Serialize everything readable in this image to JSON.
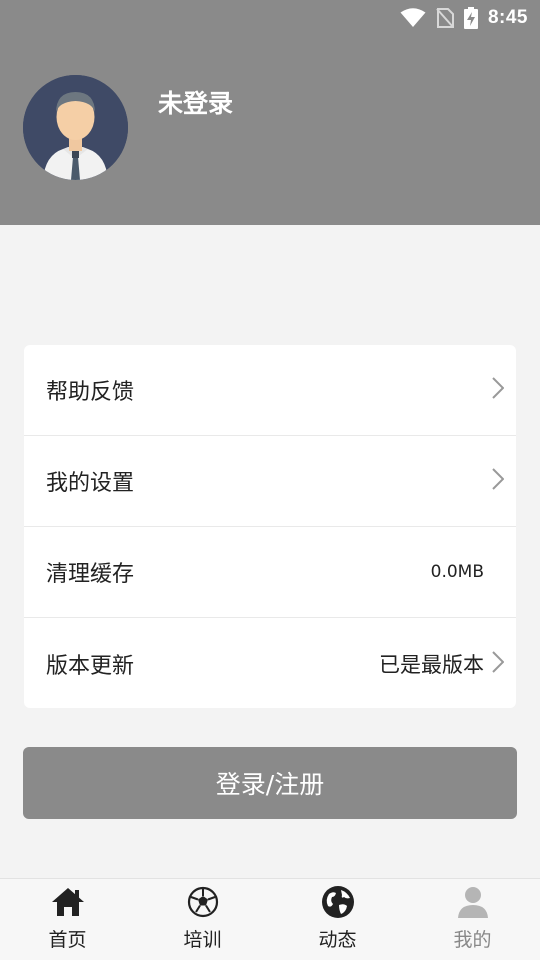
{
  "status_bar": {
    "time": "8:45"
  },
  "profile": {
    "username": "未登录"
  },
  "menu": {
    "items": [
      {
        "label": "帮助反馈",
        "value": "",
        "has_chevron": true
      },
      {
        "label": "我的设置",
        "value": "",
        "has_chevron": true
      },
      {
        "label": "清理缓存",
        "value": "0.0MB",
        "has_chevron": false
      },
      {
        "label": "版本更新",
        "value": "已是最版本",
        "has_chevron": true
      }
    ]
  },
  "login_button": {
    "label": "登录/注册"
  },
  "tab_bar": {
    "tabs": [
      {
        "label": "首页",
        "icon": "home-icon"
      },
      {
        "label": "培训",
        "icon": "soccer-ball-icon"
      },
      {
        "label": "动态",
        "icon": "globe-icon"
      },
      {
        "label": "我的",
        "icon": "person-icon"
      }
    ]
  },
  "colors": {
    "header_bg": "#8a8a8a",
    "page_bg": "#f3f3f3",
    "button_bg": "#8a8a8a",
    "active_tab": "#222222",
    "inactive_tab": "#888888"
  }
}
